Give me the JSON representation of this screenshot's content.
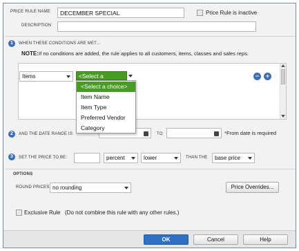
{
  "header": {
    "price_rule_name_label": "PRICE RULE NAME",
    "price_rule_name_value": "DECEMBER SPECIAL",
    "inactive_label": "Price Rule is inactive",
    "description_label": "DESCRIPTION",
    "description_value": ""
  },
  "step1": {
    "number": "1",
    "title": "WHEN THESE CONDITIONS ARE MET...",
    "note_prefix": "NOTE:",
    "note_text": "If no conditions are added, the rule applies to all customers, items, classes and sales reps.",
    "condition_type": "Items",
    "choice_selected": "<Select a choice>",
    "dropdown_options": [
      "<Select a choice>",
      "Item Name",
      "Item Type",
      "Preferred Vendor",
      "Category"
    ],
    "remove_symbol": "−",
    "add_symbol": "+"
  },
  "step2": {
    "number": "2",
    "title": "AND THE DATE RANGE IS:",
    "from_value": "",
    "to_label": "TO",
    "to_value": "",
    "required_note": "*From date is required"
  },
  "step3": {
    "number": "3",
    "title": "SET THE PRICE TO BE:",
    "amount_value": "",
    "unit_value": "percent",
    "direction_value": "lower",
    "than_the_label": "THAN THE",
    "base_value": "base price"
  },
  "options": {
    "title": "OPTIONS",
    "round_prices_label": "ROUND PRICES",
    "round_prices_value": "no rounding",
    "price_overrides_button": "Price Overrides...",
    "exclusive_label": "Exclusive Rule",
    "exclusive_note": "(Do not combine this rule with any other rules.)"
  },
  "footer": {
    "ok": "OK",
    "cancel": "Cancel",
    "help": "Help"
  },
  "colors": {
    "accent_green": "#4a9a28",
    "step_blue": "#3b6fb5",
    "ok_blue": "#2f6fc4"
  }
}
